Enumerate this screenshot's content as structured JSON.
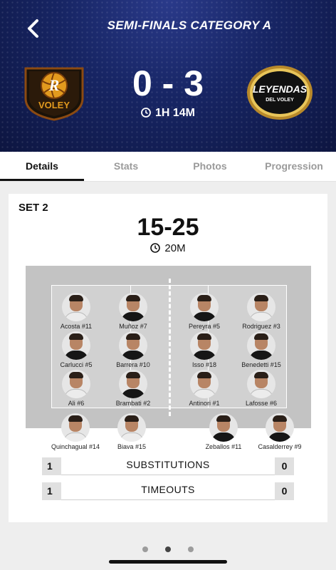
{
  "header": {
    "title": "SEMI-FINALS CATEGORY A",
    "score": "0 - 3",
    "duration": "1H 14M",
    "home_team": {
      "name": "VOLEY",
      "logo_letter": "R",
      "color": "#e29a1e"
    },
    "away_team": {
      "name_line1": "LEYENDAS",
      "name_line2": "DEL VOLEY",
      "ring_color": "#c9a23a"
    }
  },
  "tabs": [
    {
      "label": "Details",
      "active": true
    },
    {
      "label": "Stats",
      "active": false
    },
    {
      "label": "Photos",
      "active": false
    },
    {
      "label": "Progression",
      "active": false
    }
  ],
  "set": {
    "label": "SET 2",
    "score": "15-25",
    "duration": "20M"
  },
  "court": {
    "left_team": [
      {
        "name": "Acosta #11"
      },
      {
        "name": "Muñoz #7"
      },
      {
        "name": "Carlucci #5"
      },
      {
        "name": "Barrera #10"
      },
      {
        "name": "Ali #6"
      },
      {
        "name": "Brambati #2"
      }
    ],
    "right_team": [
      {
        "name": "Pereyra #5"
      },
      {
        "name": "Rodriguez #3"
      },
      {
        "name": "Isso #18"
      },
      {
        "name": "Benedetti #15"
      },
      {
        "name": "Antinori #1"
      },
      {
        "name": "Lafosse #6"
      }
    ],
    "left_liberos": [
      {
        "name": "Quinchagual #14"
      },
      {
        "name": "Biava #15"
      }
    ],
    "right_liberos": [
      {
        "name": "Zeballos #11"
      },
      {
        "name": "Casalderrey #9"
      }
    ]
  },
  "stats": [
    {
      "label": "SUBSTITUTIONS",
      "left": "1",
      "right": "0"
    },
    {
      "label": "TIMEOUTS",
      "left": "1",
      "right": "0"
    }
  ],
  "pager": {
    "pages": 3,
    "active_page": 2
  }
}
